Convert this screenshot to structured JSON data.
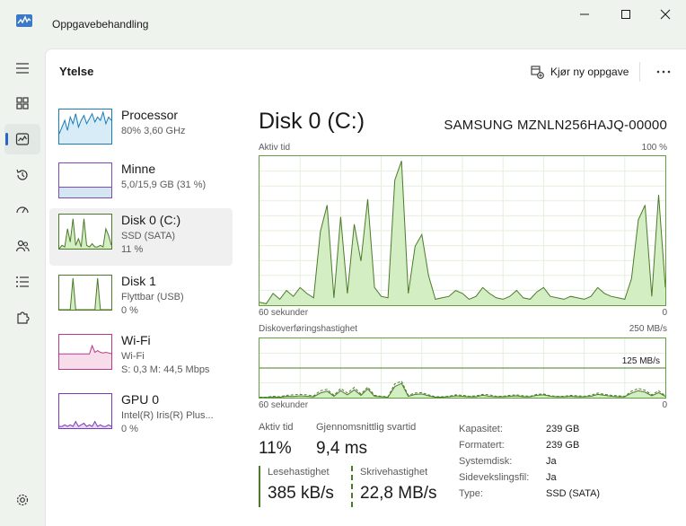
{
  "window": {
    "title": "Oppgavebehandling"
  },
  "header": {
    "page_title": "Ytelse",
    "run_task_label": "Kjør ny oppgave"
  },
  "resources": [
    {
      "name": "Processor",
      "sub1": "80%  3,60 GHz",
      "sub2": "",
      "sparkline": [
        0.3,
        0.5,
        0.7,
        0.4,
        0.8,
        0.6,
        0.9,
        0.5,
        0.7,
        0.85,
        0.6,
        0.75,
        0.9,
        0.65,
        0.8,
        0.7,
        0.95,
        0.6,
        0.8,
        0.7
      ],
      "color": "#1a7bb8",
      "fill": "#d7ecf6"
    },
    {
      "name": "Minne",
      "sub1": "5,0/15,9 GB (31 %)",
      "sub2": "",
      "sparkline": [
        0.31,
        0.31,
        0.31,
        0.31,
        0.31,
        0.31,
        0.31,
        0.31,
        0.31,
        0.31,
        0.31,
        0.31,
        0.31,
        0.31,
        0.31,
        0.31,
        0.31,
        0.31,
        0.31,
        0.31
      ],
      "color": "#7b4cb8",
      "fill": "#d5e6f3"
    },
    {
      "name": "Disk 0 (C:)",
      "sub1": "SSD (SATA)",
      "sub2": "11 %",
      "sparkline": [
        0,
        0.1,
        0.05,
        0.6,
        0.2,
        0.9,
        0.1,
        0.3,
        0.05,
        0.9,
        0.1,
        0.05,
        0.15,
        0.05,
        0.05,
        0.1,
        0.05,
        0.6,
        0.4,
        0.1
      ],
      "color": "#4c7a2a",
      "fill": "#d4eec4"
    },
    {
      "name": "Disk 1",
      "sub1": "Flyttbar (USB)",
      "sub2": "0 %",
      "sparkline": [
        0,
        0,
        0,
        0,
        0,
        0.95,
        0,
        0,
        0,
        0,
        0,
        0,
        0,
        0,
        0.95,
        0,
        0,
        0,
        0,
        0
      ],
      "color": "#4c7a2a",
      "fill": "#d4eec4"
    },
    {
      "name": "Wi-Fi",
      "sub1": "Wi-Fi",
      "sub2": "S: 0,3  M: 44,5 Mbps",
      "sparkline": [
        0.45,
        0.45,
        0.45,
        0.45,
        0.45,
        0.45,
        0.45,
        0.45,
        0.45,
        0.45,
        0.45,
        0.45,
        0.7,
        0.5,
        0.55,
        0.5,
        0.48,
        0.5,
        0.48,
        0.46
      ],
      "color": "#b83a8a",
      "fill": "#f6dde9"
    },
    {
      "name": "GPU 0",
      "sub1": "Intel(R) Iris(R) Plus...",
      "sub2": "0 %",
      "sparkline": [
        0.05,
        0.05,
        0.1,
        0.05,
        0.1,
        0.05,
        0.2,
        0.05,
        0.1,
        0.15,
        0.05,
        0.1,
        0.05,
        0.2,
        0.05,
        0.1,
        0.05,
        0.05,
        0.1,
        0.05
      ],
      "color": "#7a3ab8",
      "fill": "#e6d9f3"
    }
  ],
  "detail": {
    "title": "Disk 0 (C:)",
    "model": "SAMSUNG MZNLN256HAJQ-00000",
    "chart1_label": "Aktiv tid",
    "chart1_max": "100 %",
    "chart1_xleft": "60 sekunder",
    "chart1_xright": "0",
    "chart2_label": "Diskoverføringshastighet",
    "chart2_max": "250 MB/s",
    "chart2_mid": "125 MB/s",
    "chart2_xleft": "60 sekunder",
    "chart2_xright": "0",
    "stats": {
      "active_label": "Aktiv tid",
      "active_value": "11%",
      "resp_label": "Gjennomsnittlig svartid",
      "resp_value": "9,4 ms",
      "read_label": "Lesehastighet",
      "read_value": "385 kB/s",
      "write_label": "Skrivehastighet",
      "write_value": "22,8 MB/s"
    },
    "info": [
      {
        "key": "Kapasitet:",
        "value": "239 GB"
      },
      {
        "key": "Formatert:",
        "value": "239 GB"
      },
      {
        "key": "Systemdisk:",
        "value": "Ja"
      },
      {
        "key": "Sidevekslingsfil:",
        "value": "Ja"
      },
      {
        "key": "Type:",
        "value": "SSD (SATA)"
      }
    ]
  },
  "chart_data": [
    {
      "type": "area",
      "title": "Aktiv tid",
      "ylim": [
        0,
        100
      ],
      "x": [
        60,
        59,
        58,
        57,
        56,
        55,
        54,
        53,
        52,
        51,
        50,
        49,
        48,
        47,
        46,
        45,
        44,
        43,
        42,
        41,
        40,
        39,
        38,
        37,
        36,
        35,
        34,
        33,
        32,
        31,
        30,
        29,
        28,
        27,
        26,
        25,
        24,
        23,
        22,
        21,
        20,
        19,
        18,
        17,
        16,
        15,
        14,
        13,
        12,
        11,
        10,
        9,
        8,
        7,
        6,
        5,
        4,
        3,
        2,
        1,
        0
      ],
      "values": [
        2,
        1,
        8,
        4,
        10,
        6,
        12,
        8,
        5,
        50,
        68,
        5,
        60,
        8,
        55,
        30,
        72,
        12,
        6,
        5,
        85,
        98,
        8,
        40,
        48,
        20,
        4,
        5,
        6,
        10,
        8,
        4,
        6,
        12,
        8,
        5,
        4,
        6,
        10,
        5,
        4,
        9,
        12,
        6,
        5,
        4,
        6,
        5,
        4,
        6,
        12,
        8,
        6,
        5,
        4,
        18,
        58,
        68,
        6,
        75,
        12
      ],
      "grid": true
    },
    {
      "type": "line",
      "title": "Diskoverføringshastighet",
      "ylim": [
        0,
        250
      ],
      "x": [
        60,
        59,
        58,
        57,
        56,
        55,
        54,
        53,
        52,
        51,
        50,
        49,
        48,
        47,
        46,
        45,
        44,
        43,
        42,
        41,
        40,
        39,
        38,
        37,
        36,
        35,
        34,
        33,
        32,
        31,
        30,
        29,
        28,
        27,
        26,
        25,
        24,
        23,
        22,
        21,
        20,
        19,
        18,
        17,
        16,
        15,
        14,
        13,
        12,
        11,
        10,
        9,
        8,
        7,
        6,
        5,
        4,
        3,
        2,
        1,
        0
      ],
      "series": [
        {
          "name": "Lesehastighet",
          "values": [
            2,
            2,
            6,
            4,
            10,
            12,
            14,
            12,
            8,
            30,
            36,
            10,
            40,
            20,
            44,
            16,
            46,
            10,
            6,
            4,
            60,
            72,
            10,
            20,
            22,
            12,
            4,
            4,
            6,
            12,
            10,
            6,
            8,
            14,
            12,
            6,
            6,
            10,
            12,
            8,
            6,
            14,
            16,
            8,
            6,
            6,
            10,
            8,
            6,
            10,
            20,
            14,
            10,
            8,
            6,
            28,
            40,
            32,
            12,
            30,
            8
          ]
        },
        {
          "name": "Skrivehastighet",
          "values": [
            1,
            1,
            3,
            2,
            6,
            5,
            8,
            6,
            4,
            20,
            28,
            6,
            30,
            12,
            34,
            10,
            38,
            6,
            4,
            2,
            48,
            62,
            6,
            14,
            16,
            8,
            2,
            2,
            4,
            8,
            6,
            4,
            4,
            10,
            6,
            4,
            4,
            6,
            8,
            4,
            4,
            10,
            12,
            6,
            4,
            4,
            6,
            4,
            4,
            6,
            14,
            10,
            6,
            4,
            4,
            20,
            30,
            24,
            8,
            22,
            6
          ]
        }
      ],
      "grid": true
    }
  ]
}
